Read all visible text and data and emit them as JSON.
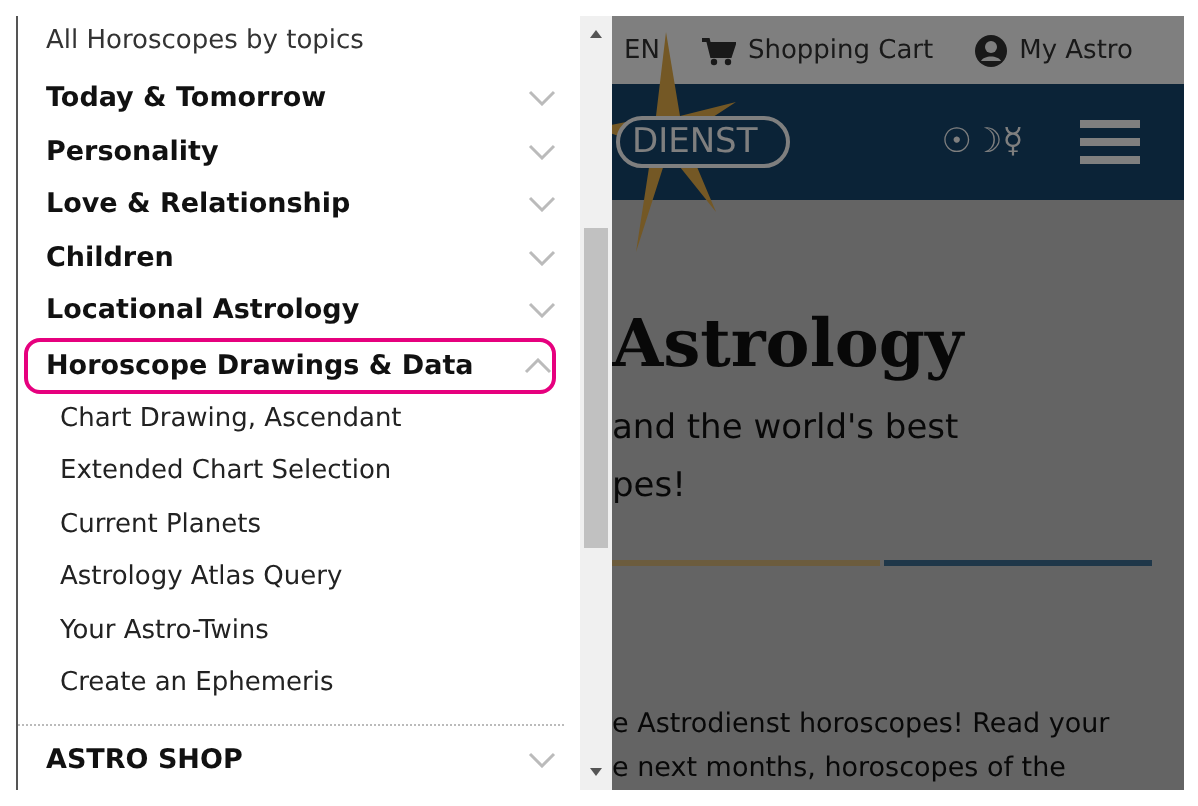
{
  "menu": {
    "heading": "All Horoscopes by topics",
    "topics": [
      {
        "label": "Today & Tomorrow",
        "expanded": false,
        "highlighted": false
      },
      {
        "label": "Personality",
        "expanded": false,
        "highlighted": false
      },
      {
        "label": "Love & Relationship",
        "expanded": false,
        "highlighted": false
      },
      {
        "label": "Children",
        "expanded": false,
        "highlighted": false
      },
      {
        "label": "Locational Astrology",
        "expanded": false,
        "highlighted": false
      },
      {
        "label": "Horoscope Drawings & Data",
        "expanded": true,
        "highlighted": true,
        "children": [
          {
            "label": "Chart Drawing, Ascendant"
          },
          {
            "label": "Extended Chart Selection"
          },
          {
            "label": "Current Planets"
          },
          {
            "label": "Astrology Atlas Query"
          },
          {
            "label": "Your Astro-Twins"
          },
          {
            "label": "Create an Ephemeris"
          }
        ]
      },
      {
        "label": "ASTRO SHOP",
        "expanded": false,
        "highlighted": false
      }
    ]
  },
  "page": {
    "language": "EN",
    "cart": "Shopping Cart",
    "account": "My Astro",
    "logo": "DIENST",
    "planet_symbols": "☉☽☿",
    "title": "Astrology",
    "subtitle_lines": [
      "and the world's best",
      "pes!"
    ],
    "body_lines": [
      "e Astrodienst horoscopes! Read your",
      "e next months, horoscopes of the"
    ]
  }
}
